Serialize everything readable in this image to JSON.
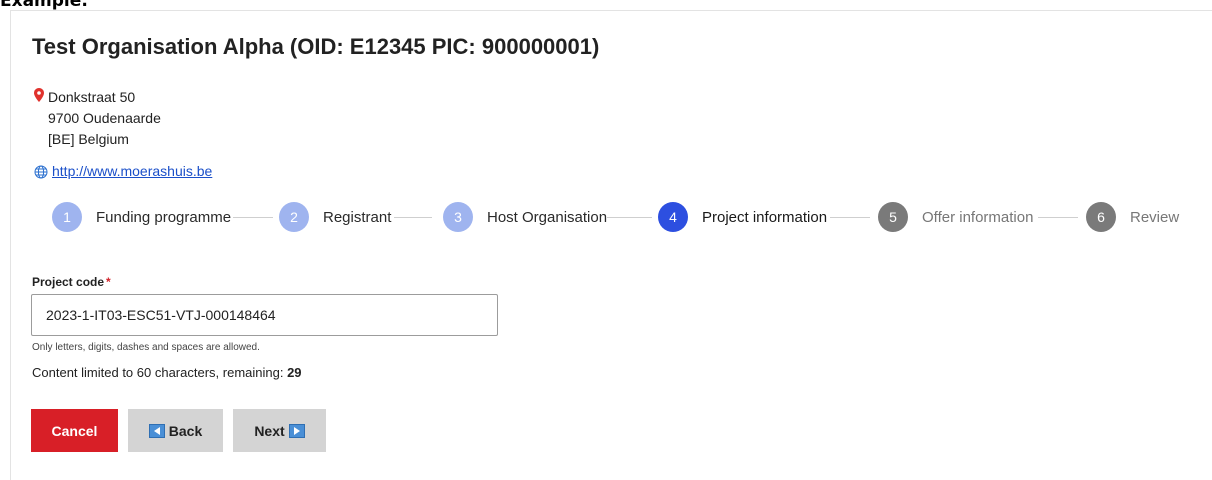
{
  "caption": "Example:",
  "organisation": {
    "title": "Test Organisation Alpha (OID: E12345 PIC: 900000001)",
    "address_lines": [
      "Donkstraat 50",
      "9700 Oudenaarde",
      "[BE] Belgium"
    ],
    "website": "http://www.moerashuis.be"
  },
  "steps": [
    {
      "number": "1",
      "label": "Funding programme",
      "state": "done"
    },
    {
      "number": "2",
      "label": "Registrant",
      "state": "done"
    },
    {
      "number": "3",
      "label": "Host Organisation",
      "state": "done"
    },
    {
      "number": "4",
      "label": "Project information",
      "state": "active"
    },
    {
      "number": "5",
      "label": "Offer information",
      "state": "todo"
    },
    {
      "number": "6",
      "label": "Review",
      "state": "todo"
    }
  ],
  "form": {
    "project_code_label": "Project code",
    "required_marker": "*",
    "project_code_value": "2023-1-IT03-ESC51-VTJ-000148464",
    "help_text": "Only letters, digits, dashes and spaces are allowed.",
    "limit_text": "Content limited to 60 characters, remaining: ",
    "remaining": "29"
  },
  "buttons": {
    "cancel": "Cancel",
    "back": "Back",
    "next": "Next"
  },
  "colors": {
    "accent": "#2d4fe0",
    "done": "#9fb4ef",
    "pending": "#7a7a7a",
    "danger": "#d81f27"
  }
}
